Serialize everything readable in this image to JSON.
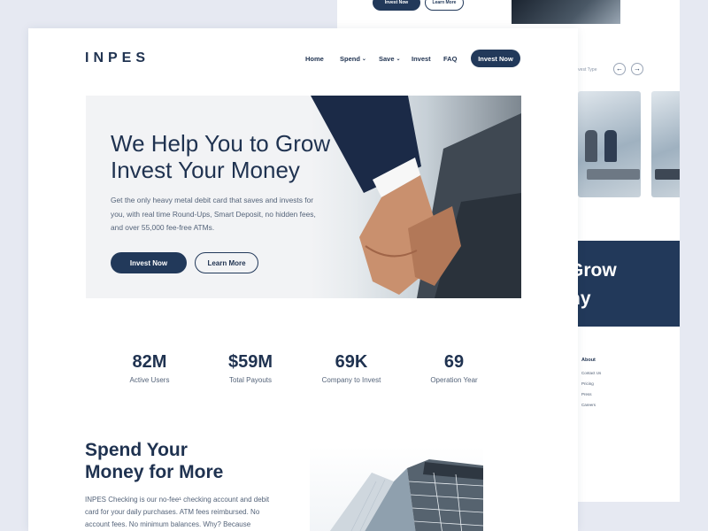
{
  "background_page": {
    "top_buttons": {
      "invest": "Invest Now",
      "learn": "Learn More"
    },
    "filter_label": "Invest Type",
    "carousel": {
      "prev_icon": "arrow-left-icon",
      "next_icon": "arrow-right-icon"
    },
    "band": {
      "line1": "Grow",
      "line2": "ny"
    },
    "footer": {
      "heading": "About",
      "links": [
        "Contact Us",
        "Pricing",
        "Press",
        "Careers"
      ]
    }
  },
  "header": {
    "logo": "INPES",
    "nav": [
      {
        "label": "Home",
        "has_dropdown": false
      },
      {
        "label": "Spend",
        "has_dropdown": true
      },
      {
        "label": "Save",
        "has_dropdown": true
      },
      {
        "label": "Invest",
        "has_dropdown": false
      },
      {
        "label": "FAQ",
        "has_dropdown": false
      }
    ],
    "cta": "Invest Now"
  },
  "hero": {
    "title_line1": "We Help You to Grow",
    "title_line2": "Invest Your Money",
    "subtitle": "Get the only heavy metal debit card that saves and invests for you, with real time Round-Ups, Smart Deposit, no hidden fees, and over 55,000 fee-free ATMs.",
    "primary_button": "Invest Now",
    "secondary_button": "Learn More"
  },
  "stats": [
    {
      "value": "82M",
      "label": "Active Users"
    },
    {
      "value": "$59M",
      "label": "Total Payouts"
    },
    {
      "value": "69K",
      "label": "Company to Invest"
    },
    {
      "value": "69",
      "label": "Operation Year"
    }
  ],
  "spend_section": {
    "title_line1": "Spend Your",
    "title_line2": "Money for More",
    "body": "INPES Checking is our no-fee¹ checking account and debit card for your daily purchases. ATM fees reimbursed. No account fees. No minimum balances. Why? Because"
  },
  "colors": {
    "brand_navy": "#22395a",
    "text_dark": "#1f3250",
    "text_muted": "#55647a",
    "hero_bg": "#f2f3f5",
    "canvas_bg": "#e6e9f2"
  }
}
